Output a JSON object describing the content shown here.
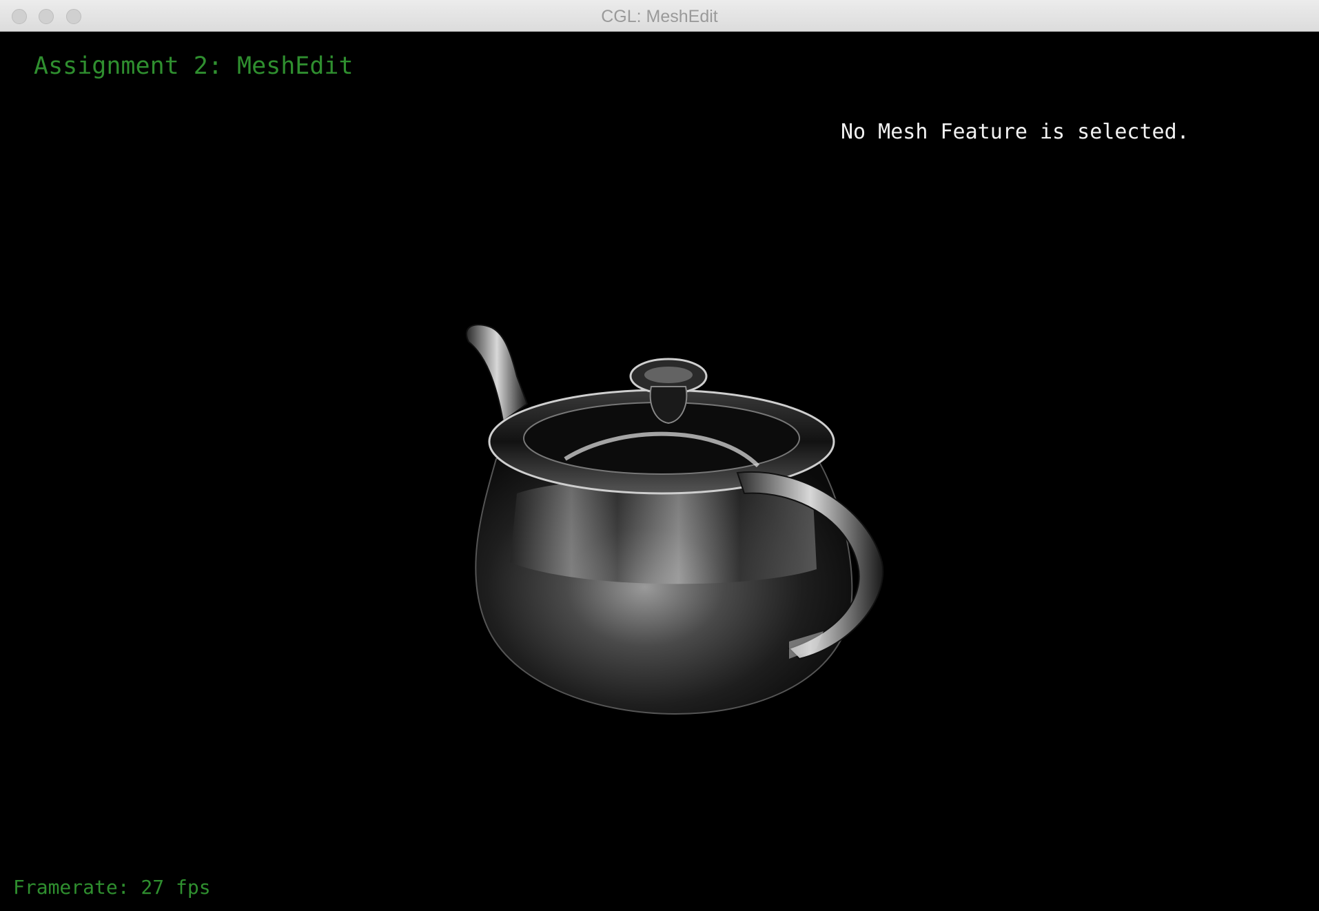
{
  "window": {
    "title": "CGL: MeshEdit"
  },
  "hud": {
    "title": "Assignment 2: MeshEdit",
    "selection_status": "No Mesh Feature is selected.",
    "framerate": "Framerate: 27 fps"
  },
  "colors": {
    "background": "#000000",
    "hud_green": "#2f8f2f",
    "status_white": "#f2f2f2"
  },
  "scene": {
    "object": "teapot",
    "material": "reflective-chrome"
  }
}
